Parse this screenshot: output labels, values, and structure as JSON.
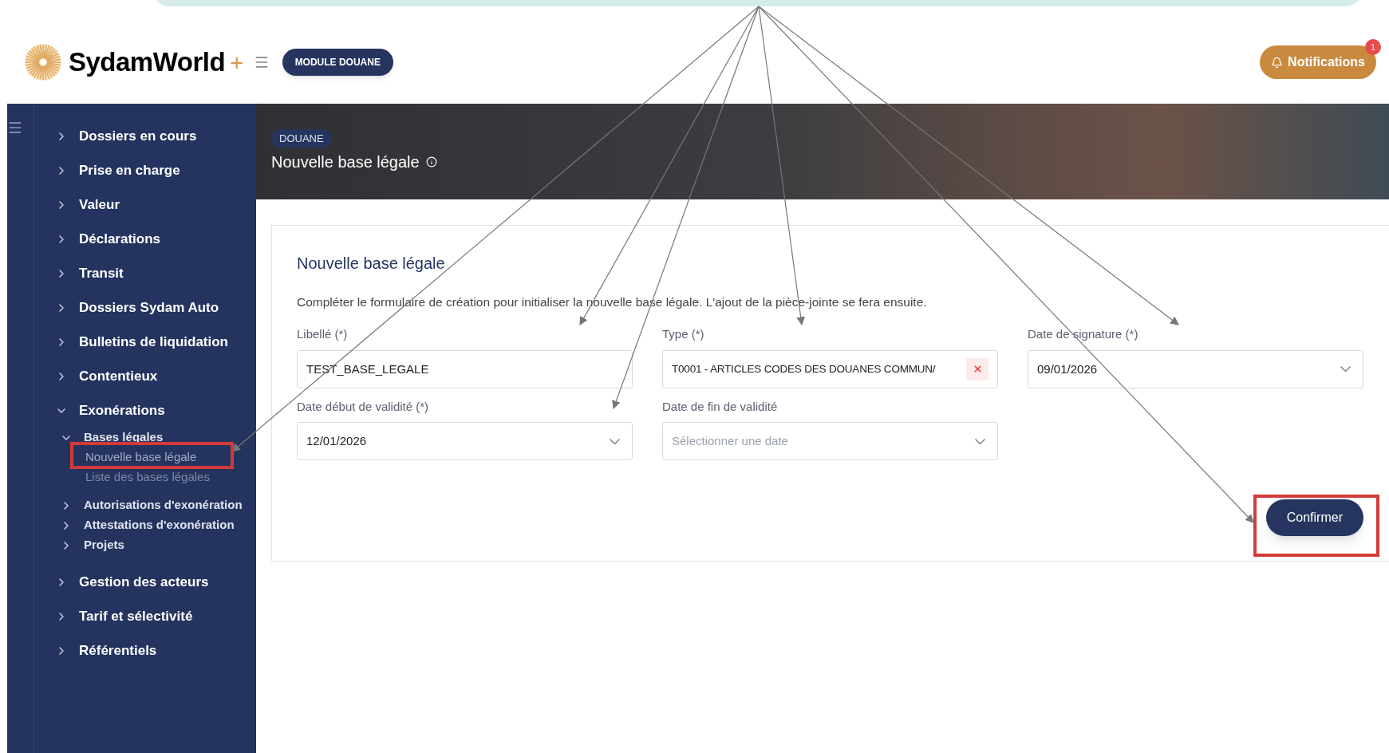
{
  "header": {
    "brand": "SydamWorld",
    "brand_suffix": "+",
    "module_button": "MODULE DOUANE",
    "notifications": {
      "label": "Notifications",
      "count": "1"
    }
  },
  "sidebar": {
    "items": [
      {
        "label": "Dossiers en cours",
        "expanded": false
      },
      {
        "label": "Prise en charge",
        "expanded": false
      },
      {
        "label": "Valeur",
        "expanded": false
      },
      {
        "label": "Déclarations",
        "expanded": false
      },
      {
        "label": "Transit",
        "expanded": false
      },
      {
        "label": "Dossiers Sydam Auto",
        "expanded": false
      },
      {
        "label": "Bulletins de liquidation",
        "expanded": false
      },
      {
        "label": "Contentieux",
        "expanded": false
      },
      {
        "label": "Exonérations",
        "expanded": true,
        "children": [
          {
            "label": "Bases légales",
            "expanded": true,
            "children": [
              {
                "label": "Nouvelle base légale",
                "selected": true
              },
              {
                "label": "Liste des bases légales",
                "selected": false
              }
            ]
          },
          {
            "label": "Autorisations d'exonération",
            "expanded": false
          },
          {
            "label": "Attestations d'exonération",
            "expanded": false
          },
          {
            "label": "Projets",
            "expanded": false
          }
        ]
      },
      {
        "label": "Gestion des acteurs",
        "expanded": false
      },
      {
        "label": "Tarif et sélectivité",
        "expanded": false
      },
      {
        "label": "Référentiels",
        "expanded": false
      }
    ]
  },
  "banner": {
    "badge": "DOUANE",
    "title": "Nouvelle base légale"
  },
  "form": {
    "title": "Nouvelle base légale",
    "intro": "Compléter le formulaire de création pour initialiser la nouvelle base légale. L'ajout de la pièce-jointe se fera ensuite.",
    "fields": [
      {
        "label": "Libellé (*)",
        "kind": "text",
        "value": "TEST_BASE_LEGALE"
      },
      {
        "label": "Type (*)",
        "kind": "select-clear",
        "value": "T0001 - ARTICLES CODES DES DOUANES COMMUN/"
      },
      {
        "label": "Date de signature (*)",
        "kind": "date",
        "value": "09/01/2026"
      },
      {
        "label": "Date début de validité (*)",
        "kind": "date",
        "value": "12/01/2026"
      },
      {
        "label": "Date de fin de validité",
        "kind": "date",
        "placeholder": "Sélectionner une date"
      }
    ],
    "confirm_button": "Confirmer"
  }
}
